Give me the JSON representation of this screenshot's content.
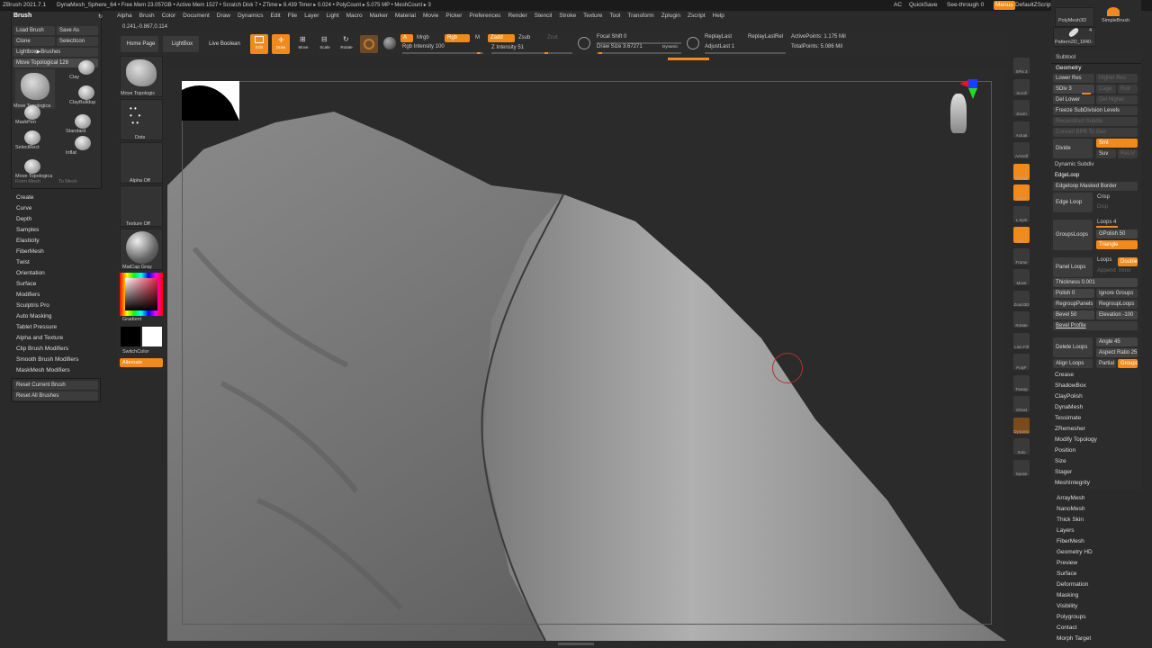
{
  "titlebar": {
    "app": "ZBrush 2021.7.1",
    "doc": "DynaMesh_Sphere_64",
    "stats": "• Free Mem 23.057GB • Active Mem 1527 • Scratch Disk 7 • ZTime ▸ 8.439 Timer ▸ 0.024 • PolyCount ▸ 5.075 MP • MeshCount ▸ 3",
    "ac": "AC",
    "quicksave": "QuickSave",
    "see_through": "See-through",
    "see_through_value": "0",
    "menus": "Menus",
    "default_zscript": "DefaultZScript"
  },
  "menubar": [
    "Alpha",
    "Brush",
    "Color",
    "Document",
    "Draw",
    "Dynamics",
    "Edit",
    "File",
    "Layer",
    "Light",
    "Macro",
    "Marker",
    "Material",
    "Movie",
    "Picker",
    "Preferences",
    "Render",
    "Stencil",
    "Stroke",
    "Texture",
    "Tool",
    "Transform",
    "Zplugin",
    "Zscript",
    "Help"
  ],
  "coords": "0.241,-0.867,0.114",
  "top_toolbar": {
    "home_page": "Home Page",
    "lightbox": "LightBox",
    "live_boolean": "Live Boolean",
    "edit": "Edit",
    "draw": "Draw",
    "move": "Move",
    "scale": "Scale",
    "rotate": "Rotate",
    "a": "A",
    "mrgb": "Mrgb",
    "rgb": "Rgb",
    "m": "M",
    "zadd": "Zadd",
    "zsub": "Zsub",
    "zcut": "Zcut",
    "rgb_intensity": "Rgb Intensity 100",
    "z_intensity": "Z Intensity 51",
    "focal_shift": "Focal Shift 0",
    "draw_size": "Draw Size 3.67271",
    "dynamic": "Dynamic",
    "replay_last": "ReplayLast",
    "replay_last_rel": "ReplayLastRel",
    "adjust_last": "AdjustLast 1",
    "active_points": "ActivePoints: 1.175 Mil",
    "total_points": "TotalPoints: 5.086 Mil"
  },
  "brush_palette": {
    "title": "Brush",
    "load_brush": "Load Brush",
    "save_as": "Save As",
    "clone": "Clone",
    "select_icon": "SelectIcon",
    "lightbox_brushes": "Lightbox▶Brushes",
    "move_topological": "Move Topological",
    "move_topological_value": "128",
    "brushes": [
      "Move Topologica",
      "Clay",
      "ClayBuildup",
      "MaskPen",
      "Standard",
      "SelectRect",
      "Inflat",
      "Move Topologica"
    ],
    "from_mesh": "From Mesh",
    "to_mesh": "To Mesh"
  },
  "left_menu": [
    "Create",
    "Curve",
    "Depth",
    "Samples",
    "Elasticity",
    "FiberMesh",
    "Twist",
    "Orientation",
    "Surface",
    "Modifiers",
    "Sculptris Pro",
    "Auto Masking",
    "Tablet Pressure",
    "Alpha and Texture",
    "Clip Brush Modifiers",
    "Smooth Brush Modifiers",
    "MaskMesh Modifiers"
  ],
  "reset_current_brush": "Reset Current Brush",
  "reset_all_brushes": "Reset All Brushes",
  "left_shelf": {
    "move_topological": "Move Topologic",
    "dots": "Dots",
    "alpha_off": "Alpha Off",
    "texture_off": "Texture Off",
    "matcap": "MatCap Gray",
    "gradient": "Gradient",
    "switch_color": "SwitchColor",
    "alternate": "Alternate"
  },
  "right_tray": [
    "SPix 3",
    "Scroll",
    "Zoom",
    "Actual",
    "AAHalf",
    "Persp",
    "Floor",
    "L.Sym",
    "Xyz",
    "Frame",
    "Move",
    "Zoom3D",
    "Rotate",
    "Line Fill",
    "PolyF",
    "Transp",
    "Ghost",
    "Dynamic",
    "Solo",
    "Xpose"
  ],
  "tool_panel": {
    "polymesh3d": "PolyMesh3D",
    "simplebrush": "SimpleBrush",
    "pattern": "Pattern2D_1840-",
    "pattern_count": "4",
    "subtool": "Subtool",
    "geometry": "Geometry",
    "lower_res": "Lower Res",
    "higher_res": "Higher Res",
    "sdiv": "SDiv 3",
    "cage": "Cage",
    "rstr": "Rstr",
    "del_lower": "Del Lower",
    "del_higher": "Del Higher",
    "freeze_subdivision": "Freeze SubDivision Levels",
    "reconstruct_subdiv": "Reconstruct Subdiv",
    "convert_bpr": "Convert BPR To Geo",
    "divide": "Divide",
    "smt": "Smt",
    "suv": "Suv",
    "reuv": "ReUV",
    "dynamic_subdiv": "Dynamic Subdiv",
    "edgeloop": "EdgeLoop",
    "edgeloop_masked_border": "Edgeloop Masked Border",
    "edge_loop": "Edge Loop",
    "crisp": "Crisp",
    "disp": "Disp",
    "groups_loops": "GroupsLoops",
    "loops4": "Loops 4",
    "gpolish": "GPolish 50",
    "triangle": "Triangle",
    "panel_loops": "Panel Loops",
    "loops": "Loops",
    "double": "Double",
    "append": "Append",
    "inner": "Inner",
    "thickness": "Thickness 0.001",
    "polish": "Polish 0",
    "ignore_groups": "Ignore Groups",
    "regroup_panels": "RegroupPanels",
    "regroup_loops": "RegroupLoops",
    "bevel": "Bevel 50",
    "elevation": "Elevation -100",
    "bevel_profile": "Bevel Profile",
    "delete_loops": "Delete Loops",
    "angle": "Angle 45",
    "aspect_ratio": "Aspect Ratio 25",
    "align_loops": "Align Loops",
    "partial": "Partial",
    "groups": "Groups",
    "list_a": [
      "Crease",
      "ShadowBox",
      "ClayPolish",
      "DynaMesh",
      "Tessimate",
      "ZRemesher",
      "Modify Topology",
      "Position",
      "Size",
      "Stager",
      "MeshIntegrity"
    ],
    "list_b": [
      "ArrayMesh",
      "NanoMesh",
      "Thick Skin",
      "Layers",
      "FiberMesh",
      "Geometry HD",
      "Preview",
      "Surface",
      "Deformation",
      "Masking",
      "Visibility",
      "Polygroups",
      "Contact",
      "Morph Target"
    ]
  },
  "colors": {
    "accent": "#f08a1c",
    "bg": "#2a2a2a",
    "canvas": "#2b2b2b"
  }
}
